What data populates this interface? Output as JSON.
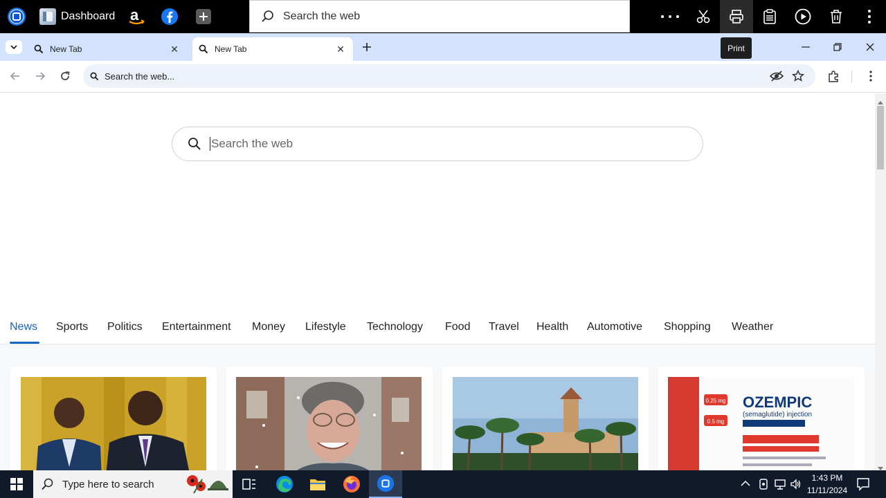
{
  "top_bar": {
    "dashboard_label": "Dashboard",
    "search_placeholder": "Search the web",
    "tooltip": "Print"
  },
  "tabs": [
    {
      "label": "New Tab",
      "active": false
    },
    {
      "label": "New Tab",
      "active": true
    }
  ],
  "address_bar": {
    "text": "Search the web..."
  },
  "main_search": {
    "placeholder": "Search the web"
  },
  "categories": [
    "News",
    "Sports",
    "Politics",
    "Entertainment",
    "Money",
    "Lifestyle",
    "Technology",
    "Food",
    "Travel",
    "Health",
    "Automotive",
    "Shopping",
    "Weather"
  ],
  "active_category": "News",
  "cards": [
    {
      "image": "men-at-podium"
    },
    {
      "image": "man-in-snow"
    },
    {
      "image": "palm-estate"
    },
    {
      "image": "ozempic-box",
      "image_text": {
        "brand": "OZEMPIC",
        "sub": "(semaglutide) injection",
        "dose1": "0.25 mg",
        "dose2": "0.5 mg"
      }
    }
  ],
  "taskbar": {
    "search_placeholder": "Type here to search",
    "time": "1:43 PM",
    "date": "11/11/2024"
  },
  "colors": {
    "accent": "#1565c0",
    "tabstrip": "#d3e3fd",
    "omnibox": "#edf2fa",
    "taskbar": "#111a2b"
  }
}
